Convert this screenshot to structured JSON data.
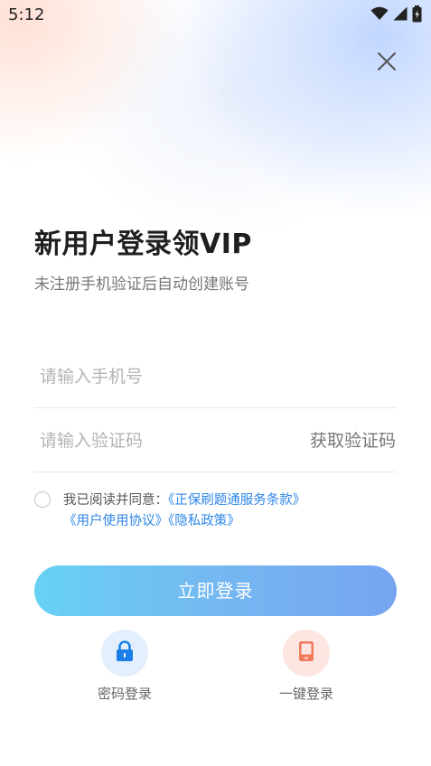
{
  "status_bar": {
    "time": "5:12"
  },
  "header": {
    "title": "新用户登录领VIP",
    "subtitle": "未注册手机验证后自动创建账号"
  },
  "form": {
    "phone_placeholder": "请输入手机号",
    "code_placeholder": "请输入验证码",
    "get_code_label": "获取验证码"
  },
  "agreement": {
    "prefix": "我已阅读并同意：",
    "terms_link": "《正保刷题通服务条款》",
    "user_link": "《用户使用协议》",
    "privacy_link": "《隐私政策》"
  },
  "login_button": {
    "label": "立即登录"
  },
  "alt_login": {
    "password_label": "密码登录",
    "one_key_label": "一键登录"
  },
  "colors": {
    "link": "#2e86e8",
    "button_gradient_start": "#67d1f3",
    "button_gradient_end": "#76a4ef",
    "password_icon": "#1a7fe6",
    "one_key_icon": "#f07a5e"
  },
  "icons": {
    "close": "close-icon",
    "password": "lock-icon",
    "one_key": "phone-icon",
    "wifi": "wifi-icon",
    "signal": "signal-icon",
    "battery": "battery-icon"
  }
}
